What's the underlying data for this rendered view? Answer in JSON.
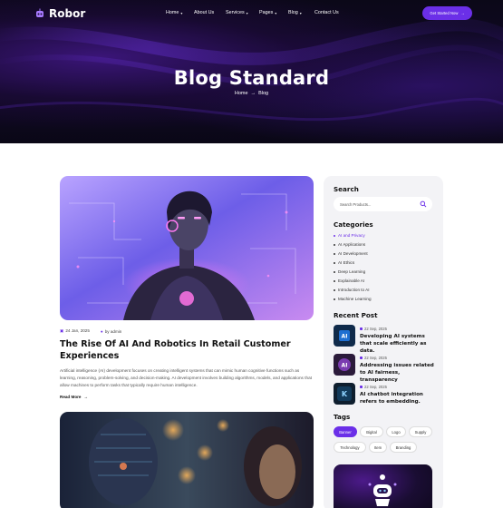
{
  "brand": {
    "name": "Robor",
    "accent": "#6b2fe8"
  },
  "nav": {
    "items": [
      {
        "label": "Home",
        "dropdown": true
      },
      {
        "label": "About Us",
        "dropdown": false
      },
      {
        "label": "Services",
        "dropdown": true
      },
      {
        "label": "Pages",
        "dropdown": true
      },
      {
        "label": "Blog",
        "dropdown": true
      },
      {
        "label": "Contact Us",
        "dropdown": false
      }
    ],
    "cta_label": "Get Started Now"
  },
  "hero": {
    "title": "Blog Standard",
    "breadcrumb": {
      "home": "Home",
      "current": "Blog"
    }
  },
  "post": {
    "date": "24 Jan, 2025",
    "author": "by admin",
    "title": "The Rise Of AI And Robotics In Retail Customer Experiences",
    "excerpt": "Artificial intelligence (AI) development focuses on creating intelligent systems that can mimic human cognitive functions such as learning, reasoning, problem-solving, and decision-making. AI development involves building algorithms, models, and applications that allow machines to perform tasks that typically require human intelligence.",
    "read_more": "Read More"
  },
  "sidebar": {
    "search_title": "Search",
    "search_placeholder": "Search Products...",
    "categories_title": "Categories",
    "categories": [
      "AI and Privacy",
      "AI Applications",
      "AI Development",
      "AI Ethics",
      "Deep Learning",
      "Explainable AI",
      "Introduction to AI",
      "Machine Learning"
    ],
    "recent_title": "Recent Post",
    "recent_posts": [
      {
        "date": "22 Sep, 2025",
        "title": "Developing AI systems that scale efficiently as data."
      },
      {
        "date": "22 Sep, 2025",
        "title": "Addressing issues related to AI fairness, transparency"
      },
      {
        "date": "22 Sep, 2025",
        "title": "AI chatbot integration refers to embedding."
      }
    ],
    "tags_title": "Tags",
    "tags": [
      "Banner",
      "Bigital",
      "Logo",
      "Supply",
      "Technology",
      "Item",
      "Branding"
    ]
  }
}
